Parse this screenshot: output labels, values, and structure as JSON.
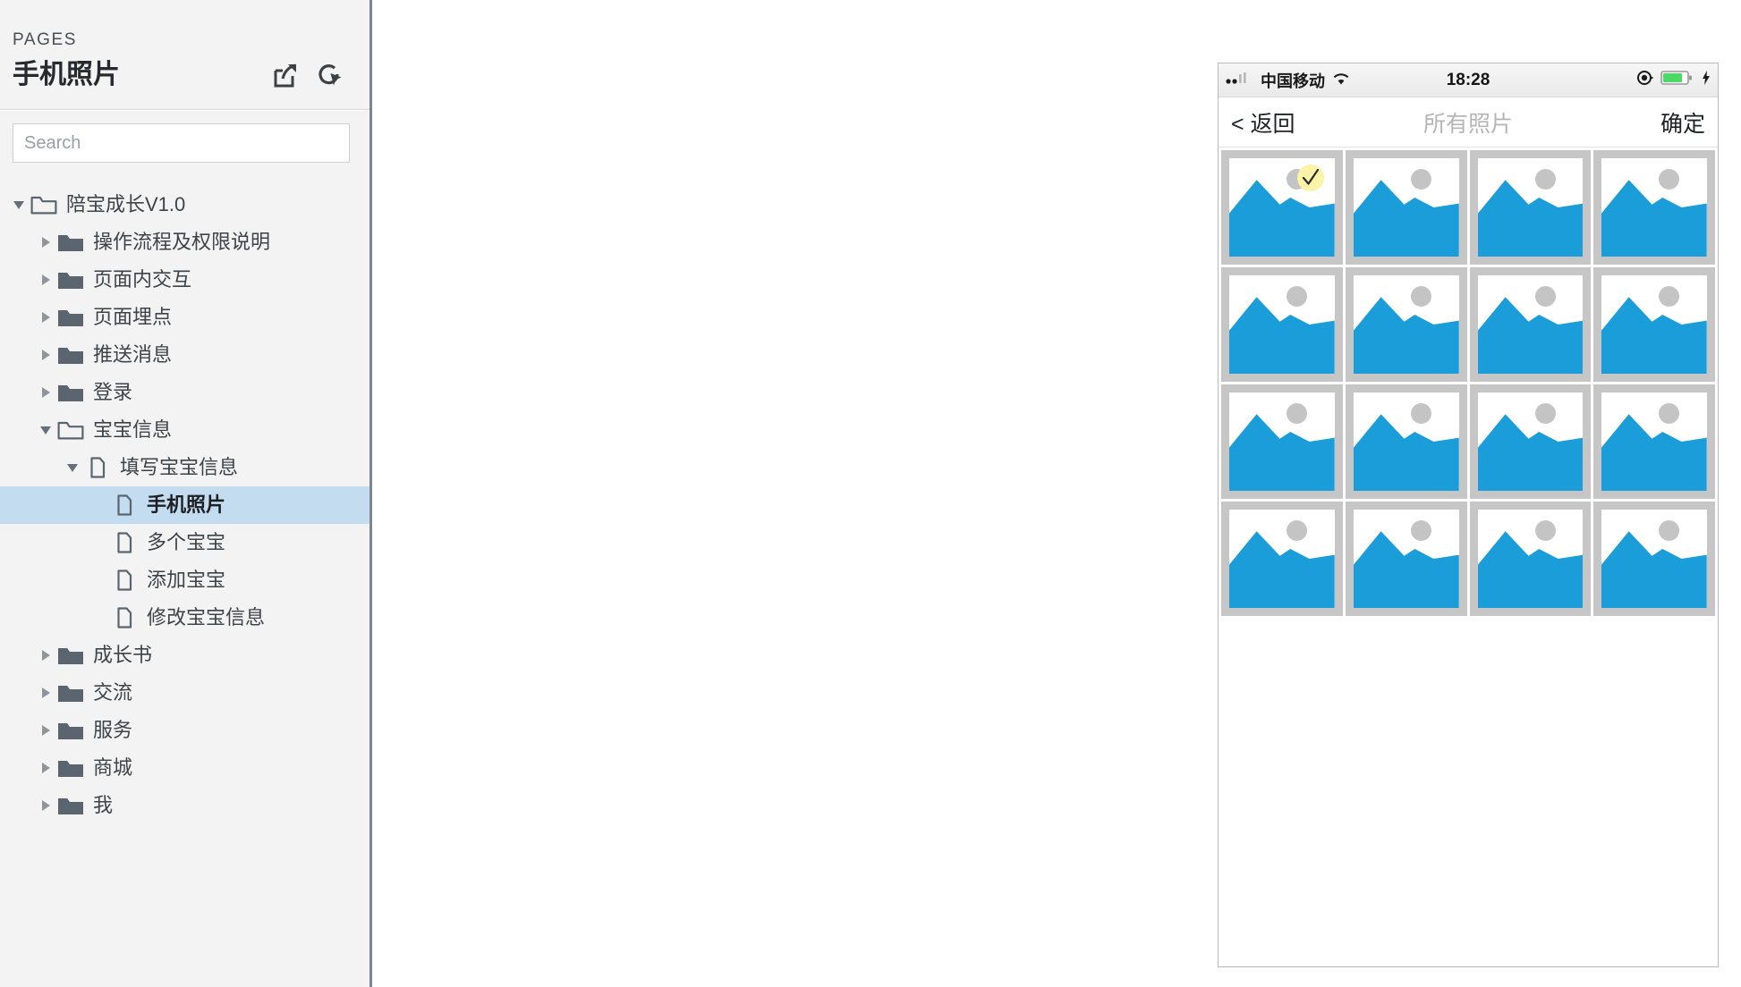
{
  "sidebar": {
    "kicker": "PAGES",
    "title": "手机照片",
    "actions": [
      {
        "name": "export-icon",
        "label": "Export"
      },
      {
        "name": "preview-icon",
        "label": "Preview"
      }
    ],
    "search": {
      "placeholder": "Search",
      "value": ""
    },
    "tree": [
      {
        "label": "陪宝成长V1.0",
        "depth": 0,
        "type": "folder-open",
        "twisty": "down",
        "selected": false
      },
      {
        "label": "操作流程及权限说明",
        "depth": 1,
        "type": "folder-closed",
        "twisty": "right",
        "selected": false
      },
      {
        "label": "页面内交互",
        "depth": 1,
        "type": "folder-closed",
        "twisty": "right",
        "selected": false
      },
      {
        "label": "页面埋点",
        "depth": 1,
        "type": "folder-closed",
        "twisty": "right",
        "selected": false
      },
      {
        "label": "推送消息",
        "depth": 1,
        "type": "folder-closed",
        "twisty": "right",
        "selected": false
      },
      {
        "label": "登录",
        "depth": 1,
        "type": "folder-closed",
        "twisty": "right",
        "selected": false
      },
      {
        "label": "宝宝信息",
        "depth": 1,
        "type": "folder-open",
        "twisty": "down",
        "selected": false
      },
      {
        "label": "填写宝宝信息",
        "depth": 2,
        "type": "page",
        "twisty": "down",
        "selected": false
      },
      {
        "label": "手机照片",
        "depth": 3,
        "type": "page",
        "twisty": "none",
        "selected": true
      },
      {
        "label": "多个宝宝",
        "depth": 3,
        "type": "page",
        "twisty": "none",
        "selected": false
      },
      {
        "label": "添加宝宝",
        "depth": 3,
        "type": "page",
        "twisty": "none",
        "selected": false
      },
      {
        "label": "修改宝宝信息",
        "depth": 3,
        "type": "page",
        "twisty": "none",
        "selected": false
      },
      {
        "label": "成长书",
        "depth": 1,
        "type": "folder-closed",
        "twisty": "right",
        "selected": false
      },
      {
        "label": "交流",
        "depth": 1,
        "type": "folder-closed",
        "twisty": "right",
        "selected": false
      },
      {
        "label": "服务",
        "depth": 1,
        "type": "folder-closed",
        "twisty": "right",
        "selected": false
      },
      {
        "label": "商城",
        "depth": 1,
        "type": "folder-closed",
        "twisty": "right",
        "selected": false
      },
      {
        "label": "我",
        "depth": 1,
        "type": "folder-closed",
        "twisty": "right",
        "selected": false
      }
    ]
  },
  "phone": {
    "status_bar": {
      "carrier": "中国移动",
      "time": "18:28",
      "signal_icon": "signal-bars-icon",
      "wifi_icon": "wifi-icon",
      "location_icon": "location-services-icon",
      "battery_icon": "battery-icon",
      "charging_icon": "charging-bolt-icon",
      "battery_color": "#4cd964"
    },
    "nav_bar": {
      "back_label": "< 返回",
      "title": "所有照片",
      "done_label": "确定"
    },
    "grid": {
      "columns": 4,
      "rows": 4,
      "placeholder_icon": "image-placeholder-icon",
      "photo_fill": "#1b9dd9",
      "frame_color": "#c6c6c6",
      "selected_indices": [
        0
      ],
      "check_badge_color": "#fbf3a8",
      "items": [
        {
          "id": 1,
          "selected": true
        },
        {
          "id": 2,
          "selected": false
        },
        {
          "id": 3,
          "selected": false
        },
        {
          "id": 4,
          "selected": false
        },
        {
          "id": 5,
          "selected": false
        },
        {
          "id": 6,
          "selected": false
        },
        {
          "id": 7,
          "selected": false
        },
        {
          "id": 8,
          "selected": false
        },
        {
          "id": 9,
          "selected": false
        },
        {
          "id": 10,
          "selected": false
        },
        {
          "id": 11,
          "selected": false
        },
        {
          "id": 12,
          "selected": false
        },
        {
          "id": 13,
          "selected": false
        },
        {
          "id": 14,
          "selected": false
        },
        {
          "id": 15,
          "selected": false
        },
        {
          "id": 16,
          "selected": false
        }
      ]
    }
  },
  "colors": {
    "sidebar_bg": "#f3f3f3",
    "selection_blue": "#c3dcf0",
    "photo_blue": "#1b9dd9",
    "frame_gray": "#c6c6c6"
  }
}
